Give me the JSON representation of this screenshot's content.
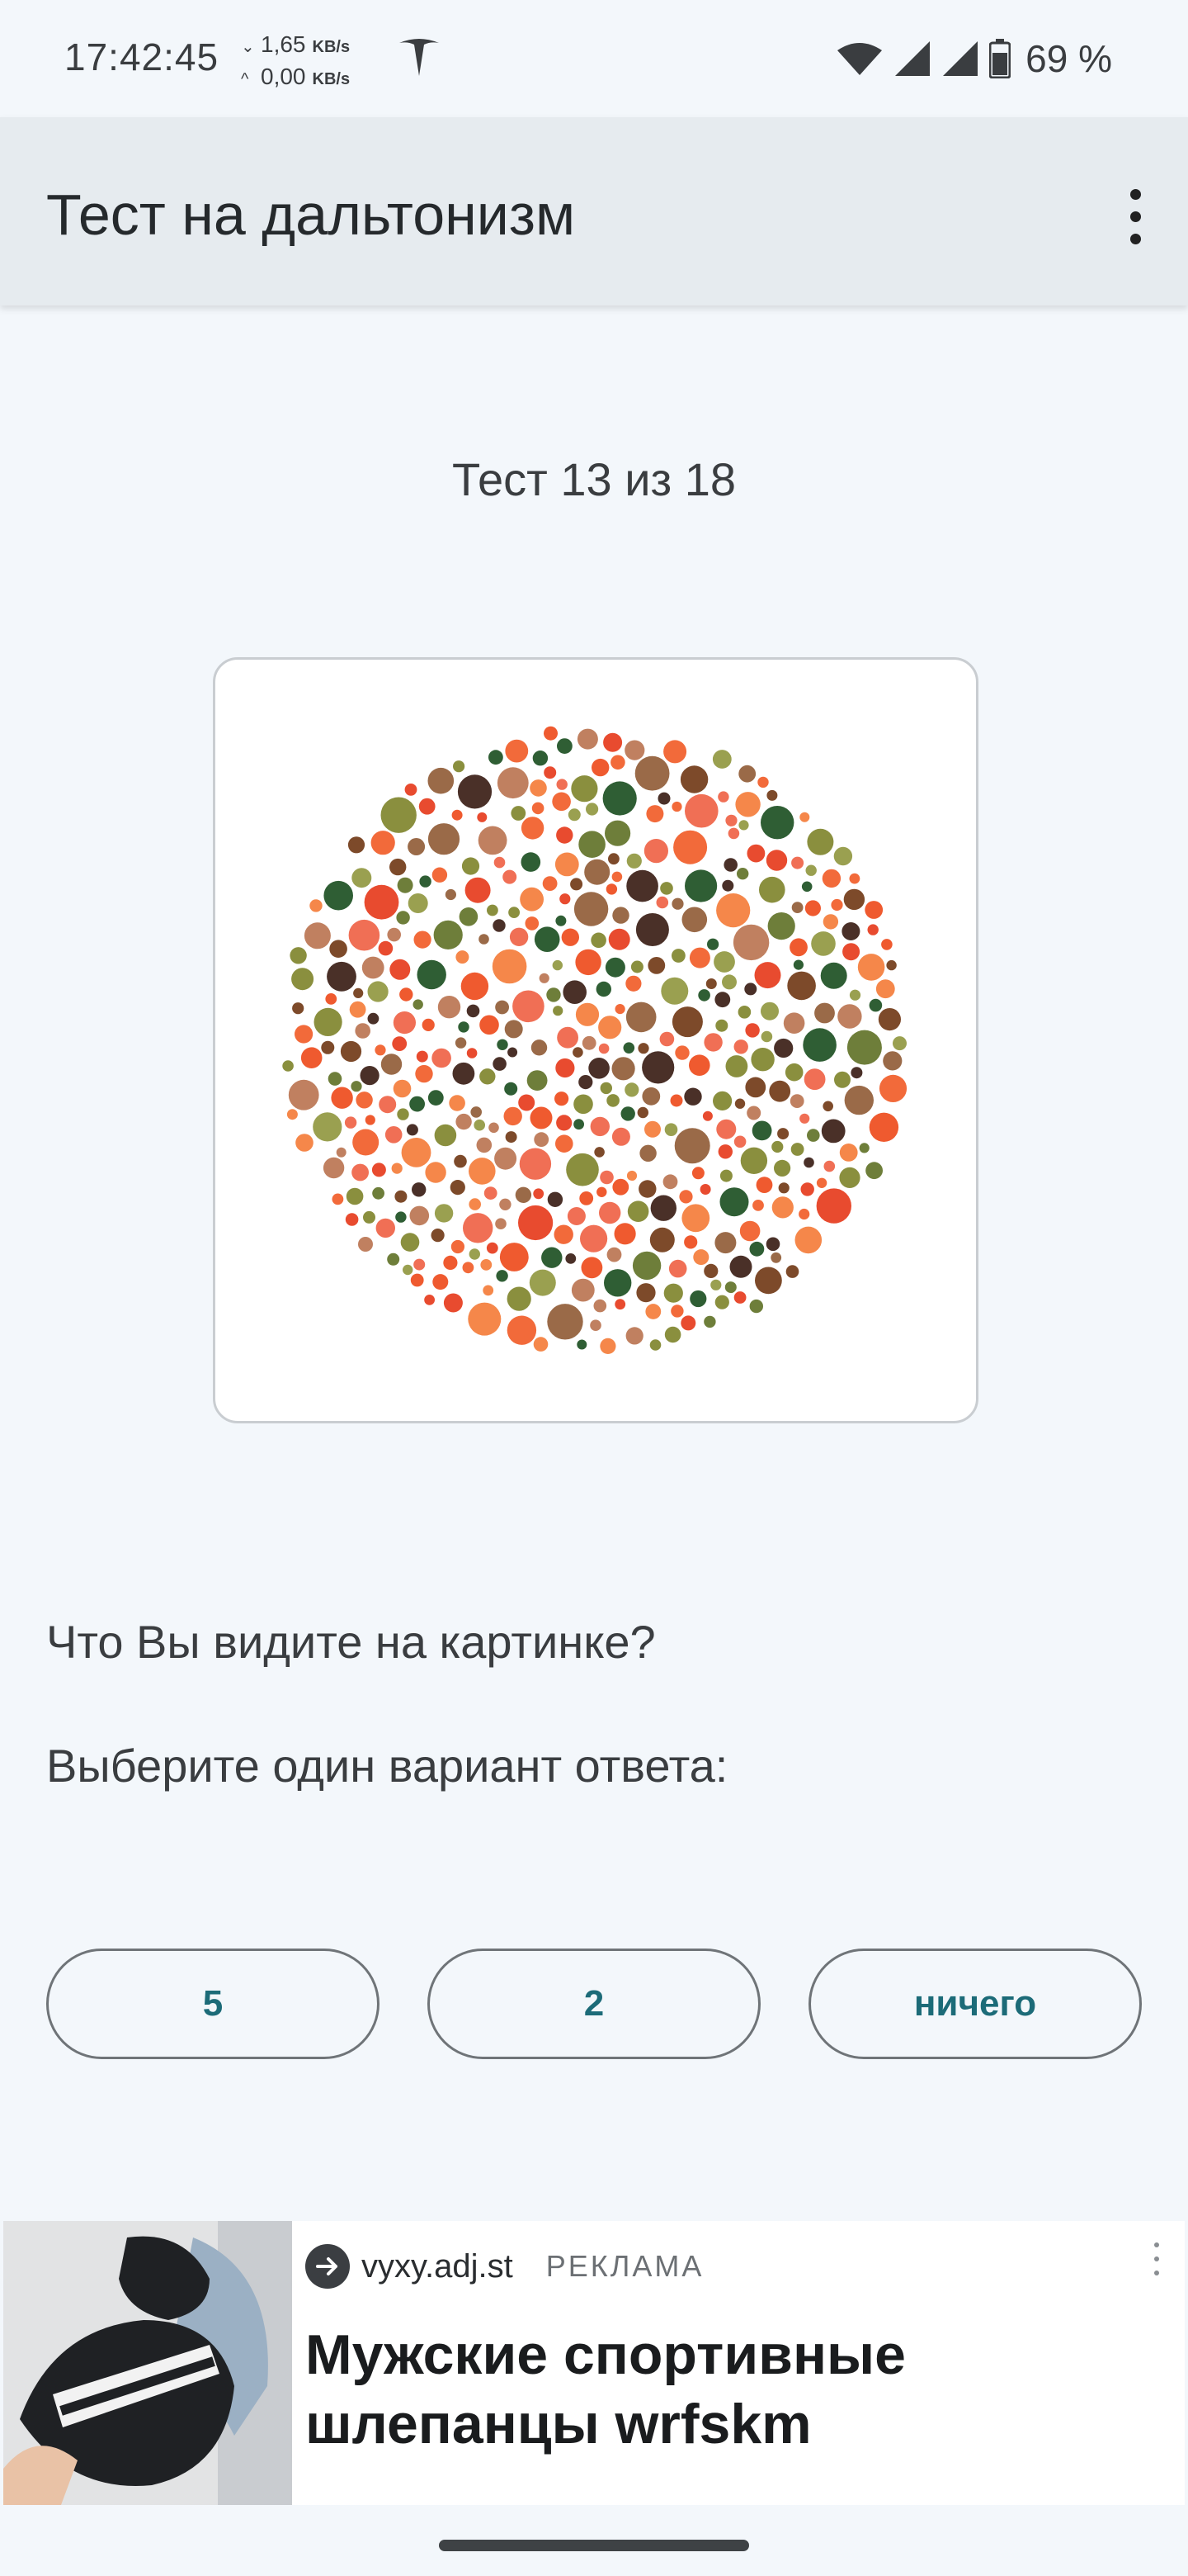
{
  "status_bar": {
    "time": "17:42:45",
    "download_speed": "1,65",
    "upload_speed": "0,00",
    "speed_unit": "KB/s",
    "battery_percent": "69 %",
    "icons": [
      "tesla-icon",
      "wifi-icon",
      "signal-icon",
      "signal-icon",
      "battery-icon"
    ]
  },
  "app_bar": {
    "title": "Тест на дальтонизм",
    "menu_icon": "more-vert-icon"
  },
  "test": {
    "counter": "Тест 13 из 18",
    "question": "Что Вы видите на картинке?",
    "instruction": "Выберите один вариант ответа:",
    "answers": [
      "5",
      "2",
      "ничего"
    ]
  },
  "ad": {
    "domain": "vyxy.adj.st",
    "label": "РЕКЛАМА",
    "title": "Мужские спортивные шлепанцы wrfskm",
    "icons": [
      "arrow-right-icon",
      "more-vert-icon"
    ]
  },
  "colors": {
    "background": "#f3f7fb",
    "app_bar": "#e6ebef",
    "accent_text": "#1c6b78",
    "plate_palette": [
      "#f26a3a",
      "#ef5a2f",
      "#e84b2f",
      "#f5874a",
      "#f06f55",
      "#8a8f3e",
      "#6e7e3a",
      "#9aa050",
      "#2f5e34",
      "#7d4a2a",
      "#9a6a48",
      "#4a3028",
      "#c08060"
    ]
  }
}
